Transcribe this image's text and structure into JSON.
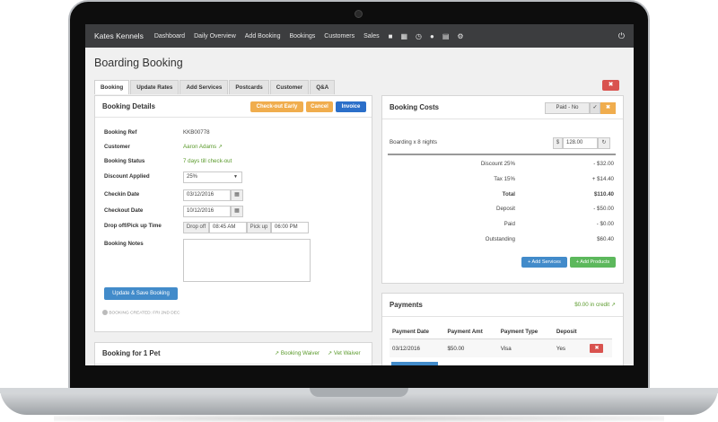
{
  "nav": {
    "brand": "Kates Kennels",
    "items": [
      "Dashboard",
      "Daily Overview",
      "Add Booking",
      "Bookings",
      "Customers",
      "Sales"
    ],
    "icons": [
      "note-icon",
      "calendar-icon",
      "clock-icon",
      "paw-icon",
      "bar-chart-icon",
      "cogs-icon"
    ],
    "power_icon": "power-icon"
  },
  "page": {
    "title": "Boarding Booking",
    "tabs": [
      "Booking",
      "Update Rates",
      "Add Services",
      "Postcards",
      "Customer",
      "Q&A"
    ],
    "active_tab": "Booking"
  },
  "details": {
    "heading": "Booking Details",
    "checkout_early": "Check-out Early",
    "cancel": "Cancel",
    "invoice": "Invoice",
    "booking_ref_label": "Booking Ref",
    "booking_ref": "KKB00778",
    "customer_label": "Customer",
    "customer": "Aaron Adams",
    "status_label": "Booking Status",
    "status": "7 days till check-out",
    "discount_label": "Discount Applied",
    "discount": "25%",
    "checkin_label": "Checkin Date",
    "checkin": "03/12/2016",
    "checkout_label": "Checkout Date",
    "checkout": "10/12/2016",
    "drop_label": "Drop off/Pick up Time",
    "drop_addon": "Drop off",
    "drop_time": "08:45 AM",
    "pick_addon": "Pick up",
    "pick_time": "06:00 PM",
    "notes_label": "Booking Notes",
    "save_button": "Update & Save Booking",
    "created_note": "BOOKING CREATED: FRI 2ND DEC"
  },
  "pets": {
    "heading": "Booking for 1 Pet",
    "waiver": "Booking Waiver",
    "vet_waiver": "Vet Waiver"
  },
  "costs": {
    "heading": "Booking Costs",
    "paid_status": "Paid - No",
    "line_label": "Boarding x 8 nights",
    "currency": "$",
    "line_value": "128.00",
    "rows": [
      {
        "k": "Discount 25%",
        "v": "- $32.00"
      },
      {
        "k": "Tax 15%",
        "v": "+ $14.40"
      },
      {
        "k": "Total",
        "v": "$110.40"
      },
      {
        "k": "Deposit",
        "v": "- $50.00"
      },
      {
        "k": "Paid",
        "v": "- $0.00"
      },
      {
        "k": "Outstanding",
        "v": "$60.40"
      }
    ],
    "add_services": "Add Services",
    "add_products": "Add Products"
  },
  "payments": {
    "heading": "Payments",
    "credit": "$0.00 in credit",
    "headers": [
      "Payment Date",
      "Payment Amt",
      "Payment Type",
      "Deposit"
    ],
    "rows": [
      [
        "03/12/2016",
        "$50.00",
        "Visa",
        "Yes"
      ]
    ]
  },
  "colors": {
    "navbar": "#3c3d3f",
    "orange": "#f0ad4e",
    "blue": "#428bca",
    "green": "#5cb85c",
    "red": "#d9534f"
  }
}
